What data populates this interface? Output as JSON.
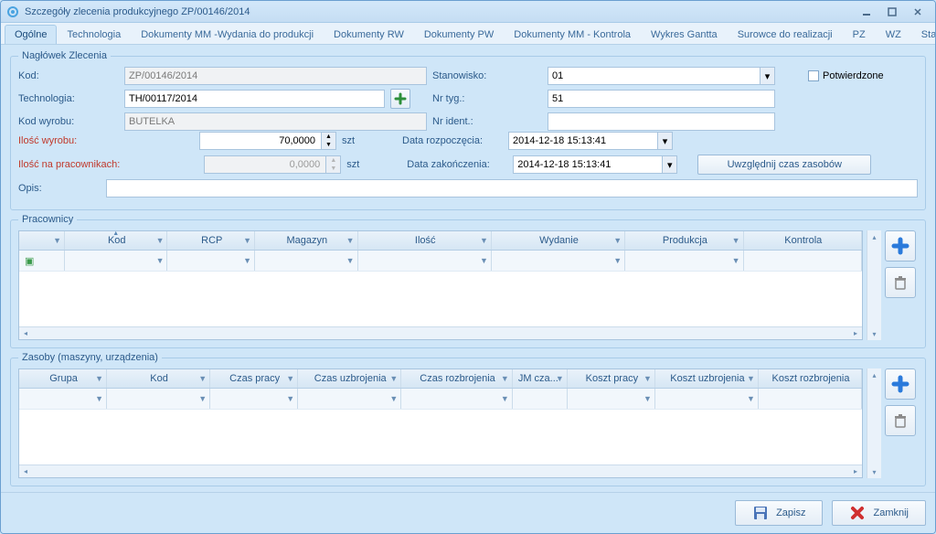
{
  "window": {
    "title": "Szczegóły zlecenia produkcyjnego ZP/00146/2014"
  },
  "tabs": {
    "items": [
      "Ogólne",
      "Technologia",
      "Dokumenty MM -Wydania do produkcji",
      "Dokumenty RW",
      "Dokumenty PW",
      "Dokumenty MM - Kontrola",
      "Wykres Gantta",
      "Surowce do realizacji",
      "PZ",
      "WZ",
      "Stany magazynowe"
    ],
    "active_index": 0
  },
  "header_section": {
    "legend": "Nagłówek Zlecenia",
    "labels": {
      "kod": "Kod:",
      "technologia": "Technologia:",
      "kod_wyrobu": "Kod wyrobu:",
      "ilosc_wyrobu": "Ilość wyrobu:",
      "ilosc_na_pracownikach": "Ilość na pracownikach:",
      "opis": "Opis:",
      "stanowisko": "Stanowisko:",
      "nr_tyg": "Nr tyg.:",
      "nr_ident": "Nr ident.:",
      "data_rozp": "Data rozpoczęcia:",
      "data_zak": "Data zakończenia:",
      "potwierdzone": "Potwierdzone",
      "uwzglednij": "Uwzględnij czas zasobów",
      "szt": "szt"
    },
    "values": {
      "kod": "ZP/00146/2014",
      "technologia": "TH/00117/2014",
      "kod_wyrobu": "BUTELKA",
      "ilosc_wyrobu": "70,0000",
      "ilosc_na_pracownikach": "0,0000",
      "opis": "",
      "stanowisko": "01",
      "nr_tyg": "51",
      "nr_ident": "",
      "data_rozp": "2014-12-18 15:13:41",
      "data_zak": "2014-12-18 15:13:41",
      "potwierdzone_checked": false
    }
  },
  "workers_section": {
    "legend": "Pracownicy",
    "columns": [
      "",
      "Kod",
      "RCP",
      "Magazyn",
      "Ilość",
      "Wydanie",
      "Produkcja",
      "Kontrola"
    ]
  },
  "resources_section": {
    "legend": "Zasoby (maszyny, urządzenia)",
    "columns": [
      "Grupa",
      "Kod",
      "Czas pracy",
      "Czas uzbrojenia",
      "Czas rozbrojenia",
      "JM cza...",
      "Koszt pracy",
      "Koszt uzbrojenia",
      "Koszt rozbrojenia"
    ]
  },
  "footer": {
    "save": "Zapisz",
    "close": "Zamknij"
  }
}
